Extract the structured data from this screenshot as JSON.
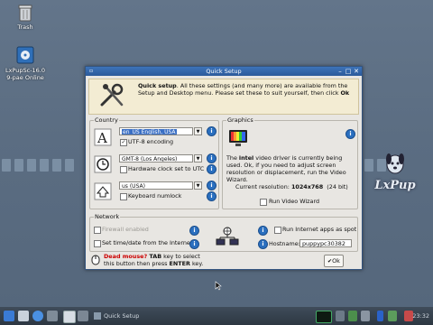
{
  "desktop": {
    "icons": [
      {
        "name": "trash",
        "label": "Trash"
      },
      {
        "name": "lxpupsc-install",
        "label_line1": "LxPupSc-16.0",
        "label_line2": "9-pae Online"
      }
    ],
    "watermark": "LxPup"
  },
  "window": {
    "title": "Quick Setup",
    "intro": {
      "bold": "Quick setup",
      "text": ". All these settings (and many more) are available from the Setup and Desktop menu. Please set these to suit yourself, then click ",
      "ok_word": "Ok"
    },
    "country": {
      "legend": "Country",
      "locale_value": "en_US      English, USA",
      "utf8_label": "UTF-8 encoding",
      "utf8_checked": true,
      "timezone_value": "GMT-8      (Los Angeles)",
      "utc_label": "Hardware clock set to UTC",
      "utc_checked": false,
      "keyboard_value": "us      (USA)",
      "numlock_label": "Keyboard numlock",
      "numlock_checked": false
    },
    "graphics": {
      "legend": "Graphics",
      "text_pre": "The ",
      "text_bold": "intel",
      "text_post": " video driver is currently being used. Ok, if you need to adjust screen resolution or displacement, run the Video Wizard.",
      "resolution_label": "Current resolution: ",
      "resolution_value": "1024x768",
      "resolution_bits": "(24 bit)",
      "wizard_label": "Run Video Wizard",
      "wizard_checked": false
    },
    "network": {
      "legend": "Network",
      "firewall_label": "Firewall enabled",
      "firewall_checked": false,
      "time_label": "Set time/date from the Internet",
      "time_checked": false,
      "spot_label": "Run Internet apps as spot",
      "spot_checked": false,
      "hostname_label": "Hostname:",
      "hostname_value": "puppypc30382"
    },
    "footer": {
      "bold1": "Dead mouse?",
      "mid1": " TAB",
      "text1": " key to select",
      "text2": "this button then press ",
      "bold2": "ENTER",
      "text3": " key.",
      "ok_label": "Ok"
    },
    "info_glyph": "i"
  },
  "taskbar": {
    "task_label": "Quick Setup",
    "clock": "23:32"
  }
}
